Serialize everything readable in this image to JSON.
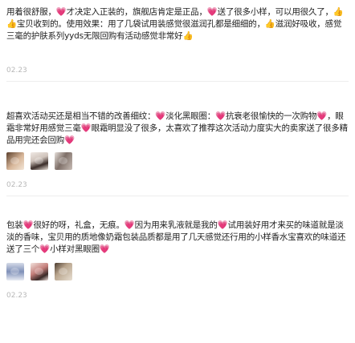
{
  "reviews": [
    {
      "text": "用着很舒服，💗才决定入正装的，旗舰店肯定是正品，💗送了很多小样，可以用很久了，👍👍宝贝收到的。使用效果：用了几袋试用装感觉很滋润孔都是细细的，👍滋润好吸收，感觉三毫的护肤系列yyds无限回购有活动感觉非常好👍",
      "date": "02.23",
      "images": []
    },
    {
      "text": "超喜欢活动买还是相当不错的改善细纹：💗淡化黑眼圈：💗抗衰老很愉快的一次购物💗，眼霜非常好用感觉三毫💗眼霜明显没了很多，太喜欢了推荐这次活动力度实大的卖家送了很多精品用完还会回购💗",
      "date": "02.23",
      "images": [
        "photo-1",
        "photo-2",
        "photo-3"
      ]
    },
    {
      "text": "包装💗很好的呀，礼盒，无痕。💗因为用来乳液就是我的💗试用装好用才来买的味道就是淡淡的香味，宝贝用的质地像奶霜包装品质都是用了几天感觉还行用的小样香水宝喜欢的味道还送了三个💗小样对黑眼圈💗",
      "date": "02.23",
      "images": [
        "photo-4",
        "photo-5",
        "photo-6"
      ]
    }
  ]
}
